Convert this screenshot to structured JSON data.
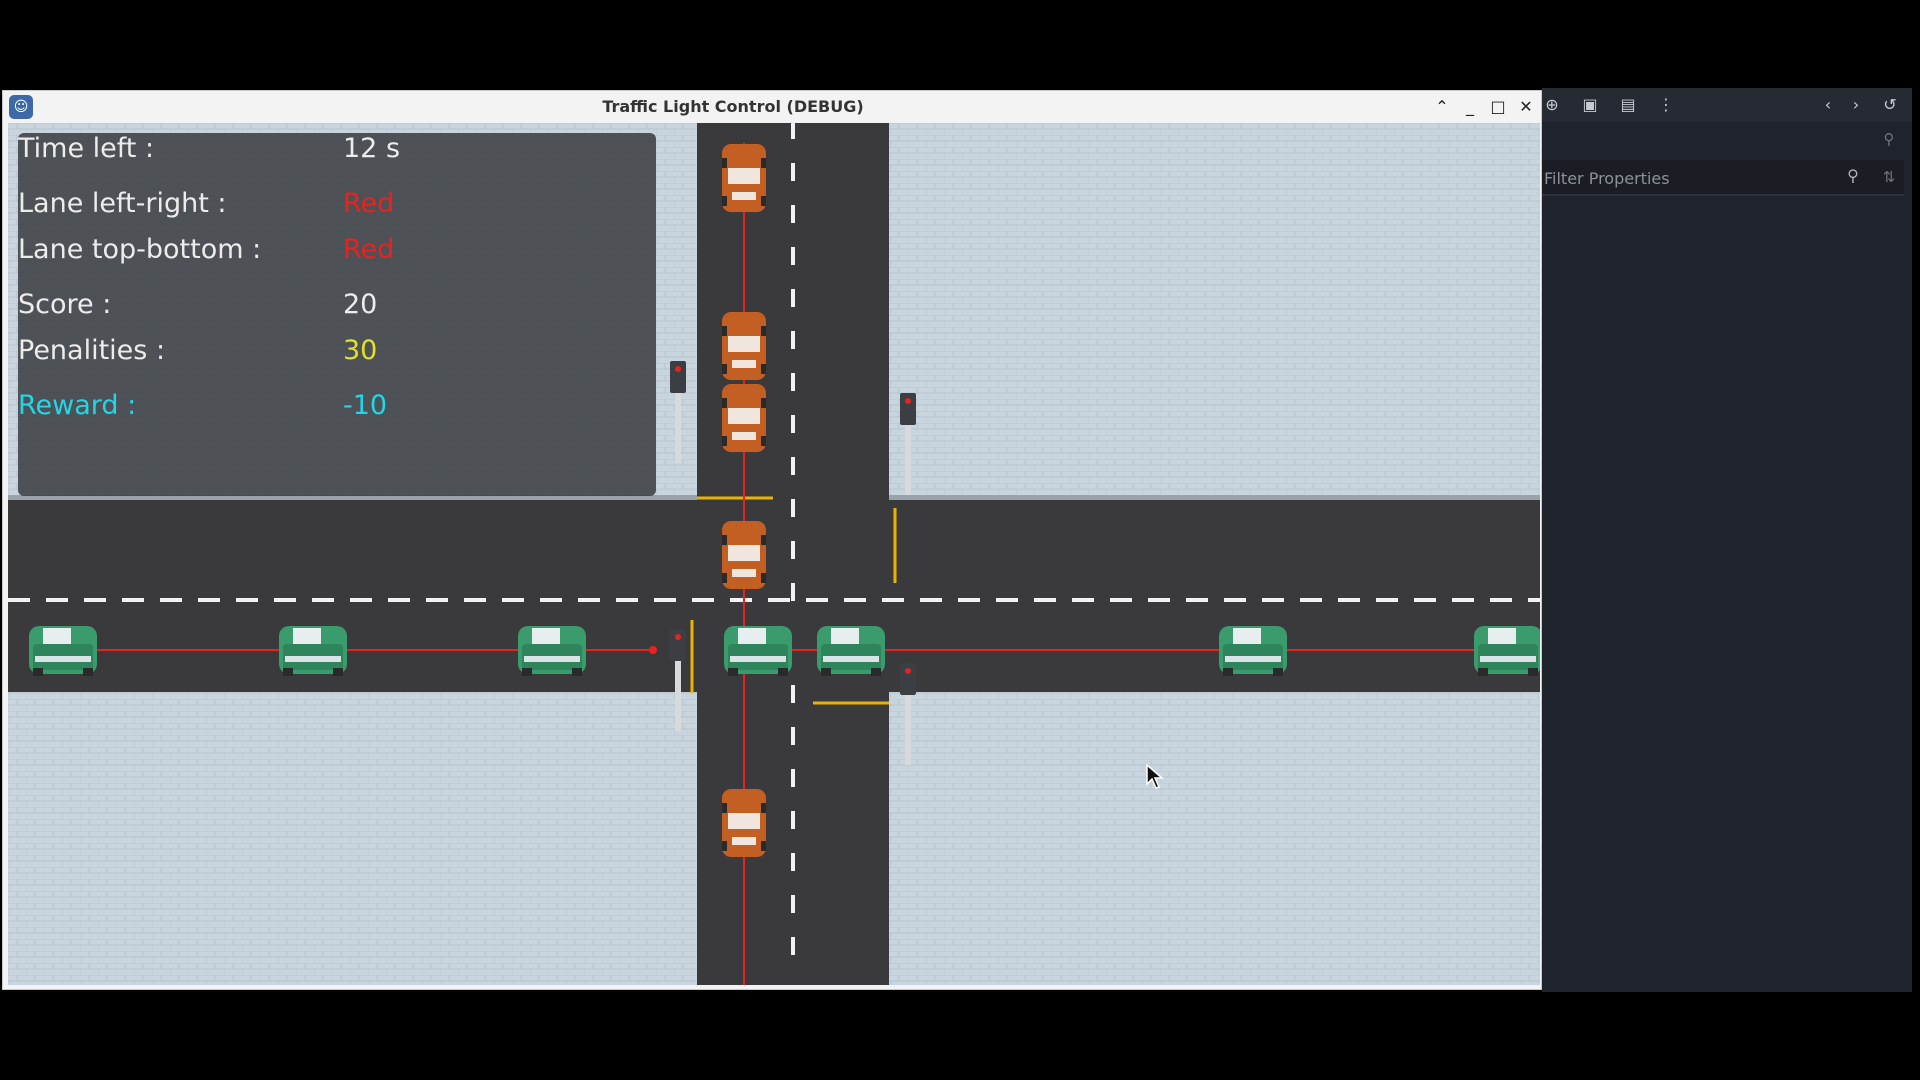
{
  "window": {
    "title": "Traffic Light Control (DEBUG)"
  },
  "hud": {
    "time_left_label": "Time left :",
    "time_left_value": "12 s",
    "lane_lr_label": "Lane left-right :",
    "lane_lr_value": "Red",
    "lane_tb_label": "Lane top-bottom :",
    "lane_tb_value": "Red",
    "score_label": "Score :",
    "score_value": "20",
    "penalties_label": "Penalities  :",
    "penalties_value": "30",
    "reward_label": "Reward :",
    "reward_value": "-10"
  },
  "editor": {
    "filter_placeholder": "Filter Properties"
  },
  "colors": {
    "road": "#3a3a3c",
    "sidewalk": "#c7d3dc",
    "hud_white": "#ececec",
    "lane_red": "#e8231f",
    "penalty_yellow": "#e3e027",
    "reward_cyan": "#23d6e6",
    "car_green": "#3a9b6c",
    "car_orange": "#c45f23",
    "stop_line_yellow": "#e9b400"
  },
  "icons": {
    "app": "godot-icon",
    "search": "search-icon",
    "history": "history-icon",
    "more": "more-vert-icon"
  }
}
